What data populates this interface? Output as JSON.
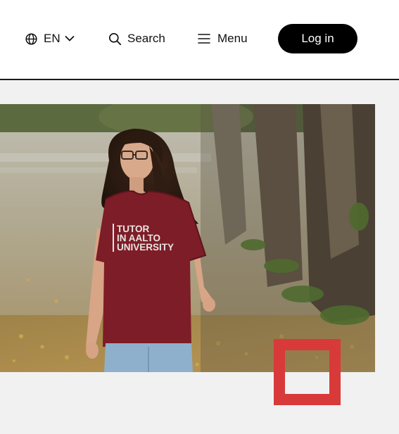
{
  "header": {
    "language": {
      "label": "EN",
      "icon": "globe-icon",
      "dropdown_icon": "chevron-down-icon"
    },
    "search": {
      "label": "Search",
      "icon": "search-icon"
    },
    "menu": {
      "label": "Menu",
      "icon": "hamburger-icon"
    },
    "login": {
      "label": "Log in"
    }
  },
  "hero": {
    "shirt_text": [
      "TUTOR",
      "IN AALTO",
      "UNIVERSITY"
    ]
  },
  "colors": {
    "accent_red": "#d83a3a",
    "login_bg": "#000000",
    "page_bg": "#f1f1f1"
  }
}
